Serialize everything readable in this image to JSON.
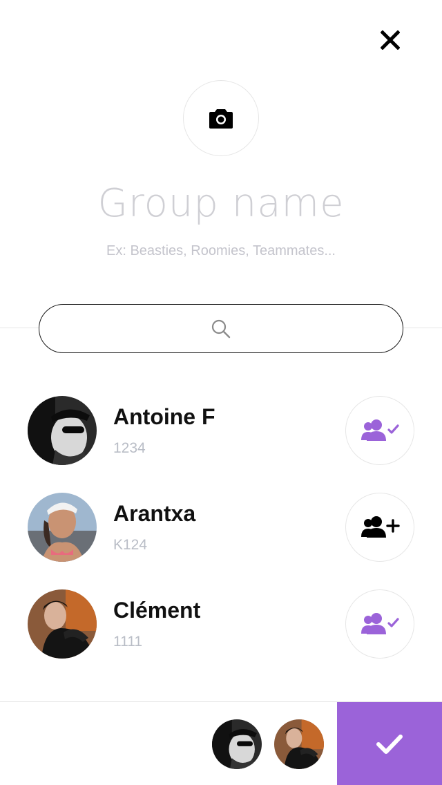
{
  "header": {
    "close_icon": "close-icon",
    "camera_icon": "camera-icon"
  },
  "group": {
    "name_placeholder": "Group name",
    "hint": "Ex: Beasties, Roomies, Teammates..."
  },
  "search": {
    "icon": "search-icon"
  },
  "contacts": [
    {
      "name": "Antoine F",
      "id": "1234",
      "status": "added",
      "action_icon": "group-check-icon"
    },
    {
      "name": "Arantxa",
      "id": "K124",
      "status": "not-added",
      "action_icon": "add-person-icon"
    },
    {
      "name": "Clément",
      "id": "1111",
      "status": "added",
      "action_icon": "group-check-icon"
    }
  ],
  "selected": {
    "members": [
      "Antoine F",
      "Clément"
    ]
  },
  "confirm": {
    "icon": "checkmark-icon"
  },
  "colors": {
    "accent": "#9b63d9",
    "text_primary": "#111111",
    "text_secondary": "#b9bdc6",
    "placeholder": "#cfcfd4"
  }
}
